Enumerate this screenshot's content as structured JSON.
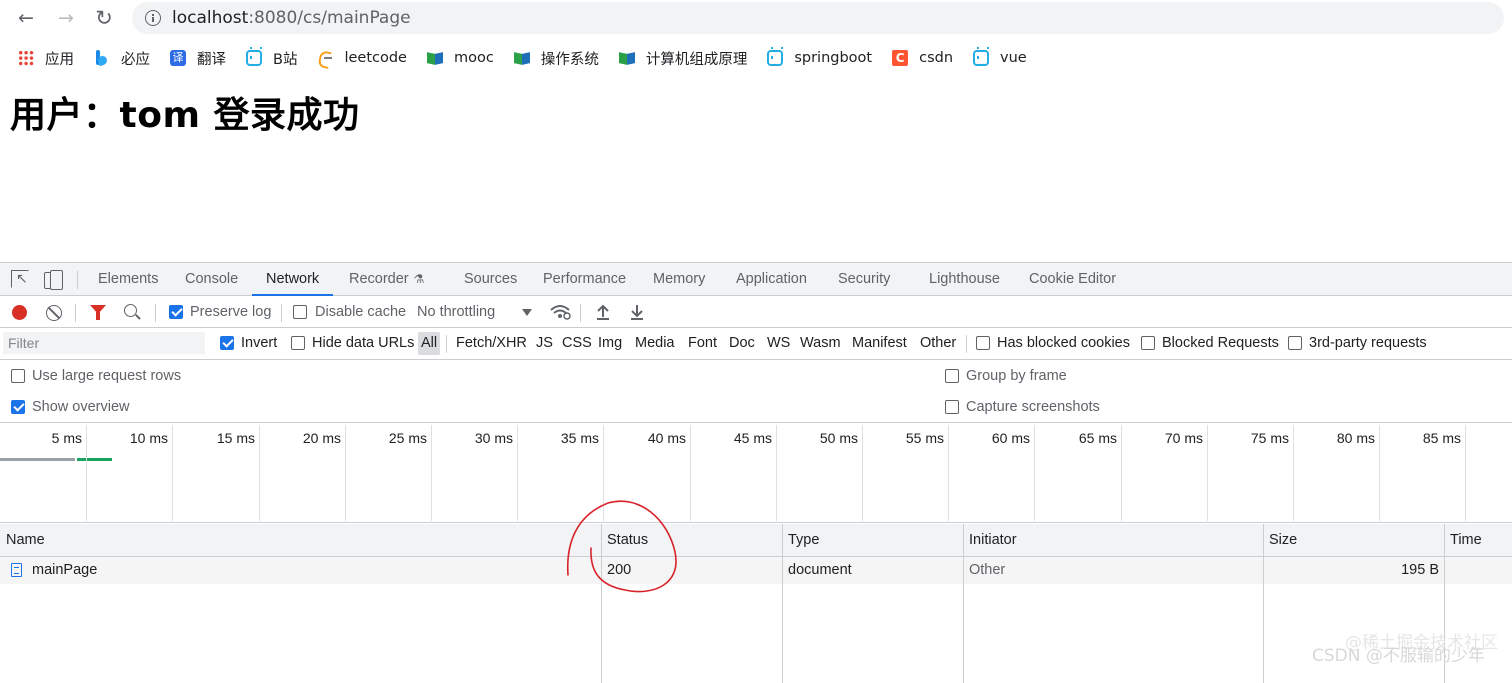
{
  "browser": {
    "url_host": "localhost",
    "url_path": ":8080/cs/mainPage",
    "nav": {
      "back": "←",
      "forward": "→",
      "reload": "↻"
    },
    "bookmarks": [
      {
        "label": "应用",
        "icon": "apps-grid-icon"
      },
      {
        "label": "必应",
        "icon": "bing-icon"
      },
      {
        "label": "翻译",
        "icon": "translate-icon",
        "glyph": "译"
      },
      {
        "label": "B站",
        "icon": "bilibili-icon"
      },
      {
        "label": "leetcode",
        "icon": "leetcode-icon"
      },
      {
        "label": "mooc",
        "icon": "mooc-icon"
      },
      {
        "label": "操作系统",
        "icon": "mooc-icon"
      },
      {
        "label": "计算机组成原理",
        "icon": "mooc-icon"
      },
      {
        "label": "springboot",
        "icon": "bilibili-icon"
      },
      {
        "label": "csdn",
        "icon": "csdn-icon",
        "glyph": "C"
      },
      {
        "label": "vue",
        "icon": "bilibili-icon"
      }
    ]
  },
  "page": {
    "heading": "用户：tom 登录成功"
  },
  "devtools": {
    "tabs": [
      {
        "label": "Elements",
        "active": false
      },
      {
        "label": "Console",
        "active": false
      },
      {
        "label": "Network",
        "active": true
      },
      {
        "label": "Recorder",
        "active": false
      },
      {
        "label": "Sources",
        "active": false
      },
      {
        "label": "Performance",
        "active": false
      },
      {
        "label": "Memory",
        "active": false
      },
      {
        "label": "Application",
        "active": false
      },
      {
        "label": "Security",
        "active": false
      },
      {
        "label": "Lighthouse",
        "active": false
      },
      {
        "label": "Cookie Editor",
        "active": false
      }
    ],
    "toolbar": {
      "preserve_log": {
        "label": "Preserve log",
        "checked": true
      },
      "disable_cache": {
        "label": "Disable cache",
        "checked": false
      },
      "throttling": "No throttling"
    },
    "filter": {
      "placeholder": "Filter",
      "invert": {
        "label": "Invert",
        "checked": true
      },
      "hide_data_urls": {
        "label": "Hide data URLs",
        "checked": false
      },
      "types": [
        "All",
        "Fetch/XHR",
        "JS",
        "CSS",
        "Img",
        "Media",
        "Font",
        "Doc",
        "WS",
        "Wasm",
        "Manifest",
        "Other"
      ],
      "selected_type": "All",
      "has_blocked_cookies": {
        "label": "Has blocked cookies",
        "checked": false
      },
      "blocked_requests": {
        "label": "Blocked Requests",
        "checked": false
      },
      "third_party": {
        "label": "3rd-party requests",
        "checked": false
      }
    },
    "settings": {
      "large_rows": {
        "label": "Use large request rows",
        "checked": false
      },
      "show_overview": {
        "label": "Show overview",
        "checked": true
      },
      "group_by_frame": {
        "label": "Group by frame",
        "checked": false
      },
      "capture_screenshots": {
        "label": "Capture screenshots",
        "checked": false
      }
    },
    "overview_ticks": [
      "5 ms",
      "10 ms",
      "15 ms",
      "20 ms",
      "25 ms",
      "30 ms",
      "35 ms",
      "40 ms",
      "45 ms",
      "50 ms",
      "55 ms",
      "60 ms",
      "65 ms",
      "70 ms",
      "75 ms",
      "80 ms",
      "85 ms"
    ],
    "table": {
      "columns": [
        "Name",
        "Status",
        "Type",
        "Initiator",
        "Size",
        "Time"
      ],
      "rows": [
        {
          "name": "mainPage",
          "status": "200",
          "type": "document",
          "initiator": "Other",
          "size": "195 B",
          "time": ""
        }
      ]
    }
  },
  "watermark": "CSDN @不服输的少年",
  "watermark_secondary": "@稀土掘金技术社区",
  "colors": {
    "accent": "#1a73e8",
    "record": "#d93025",
    "annotation": "#d8232a",
    "overview_gray": "#9aa0a6",
    "overview_green": "#1aa260"
  }
}
